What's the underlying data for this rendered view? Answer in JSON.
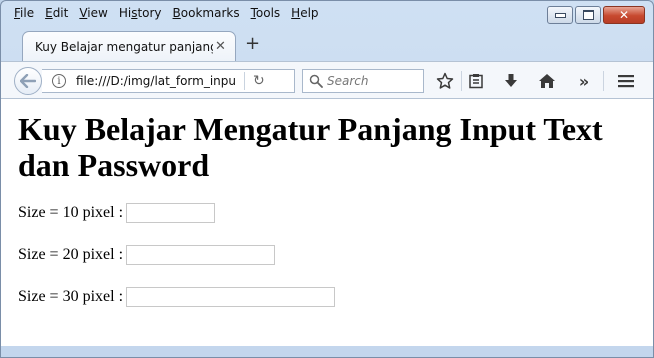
{
  "menubar": {
    "items": [
      {
        "ul": "F",
        "rest": "ile"
      },
      {
        "ul": "E",
        "rest": "dit"
      },
      {
        "ul": "V",
        "rest": "iew"
      },
      {
        "pre": "Hi",
        "ul": "s",
        "rest": "tory"
      },
      {
        "ul": "B",
        "rest": "ookmarks"
      },
      {
        "ul": "T",
        "rest": "ools"
      },
      {
        "ul": "H",
        "rest": "elp"
      }
    ]
  },
  "tab": {
    "title": "Kuy Belajar mengatur panjang i...",
    "close": "✕",
    "new_tab": "+"
  },
  "navbar": {
    "url": "file:///D:/img/lat_form_input_",
    "search_placeholder": "Search",
    "overflow": "»"
  },
  "page": {
    "title": "Kuy Belajar Mengatur Panjang Input Text dan Password",
    "fields": [
      {
        "label": "Size = 10 pixel :",
        "size": 10,
        "value": ""
      },
      {
        "label": "Size = 20 pixel :",
        "size": 20,
        "value": ""
      },
      {
        "label": "Size = 30 pixel :",
        "size": 30,
        "value": ""
      }
    ]
  }
}
